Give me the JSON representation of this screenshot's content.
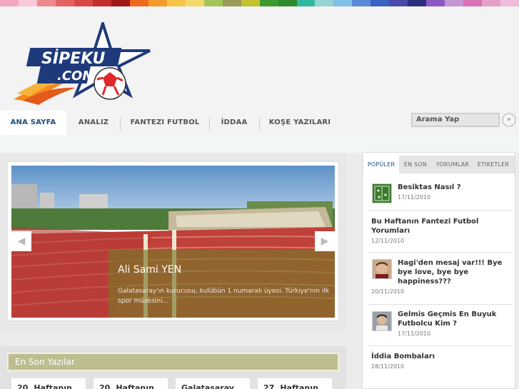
{
  "colors": {
    "strip": [
      "#f5a7c4",
      "#f7c9d6",
      "#ec8a8a",
      "#e36262",
      "#d94848",
      "#c42e2e",
      "#a01818",
      "#f06a1e",
      "#f49b2b",
      "#f7c44a",
      "#f5d86a",
      "#a3c459",
      "#9a9a5a",
      "#c2c22e",
      "#3d9b2e",
      "#2d8a2d",
      "#33b8a0",
      "#9ad3d3",
      "#7ec0e6",
      "#5a8ad6",
      "#3a62c2",
      "#4a4aaa",
      "#2e2e7e",
      "#8a5ac2",
      "#c496d6",
      "#d672b5",
      "#e6a0c8",
      "#f0bcd9"
    ],
    "nav_active_text": "#1e4b78",
    "latest_header_bg": "#bdbd8e"
  },
  "logo": {
    "text_line1": "SİPEKU",
    "text_line2": ".COM"
  },
  "nav": {
    "tabs": [
      {
        "label": "ANA SAYFA",
        "active": true
      },
      {
        "label": "ANALIZ"
      },
      {
        "label": "FANTEZI FUTBOL"
      },
      {
        "label": "İDDAA"
      },
      {
        "label": "KOŞE YAZILARI"
      }
    ]
  },
  "search": {
    "placeholder": "Arama Yap",
    "button_icon": "»"
  },
  "slider": {
    "title": "Ali Sami YEN",
    "text": "Galatasaray'ın kurucusu, kulübün 1 numaralı üyesi. Türkiye'nin ilk spor müzesini...",
    "prev_icon": "◀",
    "next_icon": "▶"
  },
  "latest": {
    "header": "En Son Yazılar",
    "cards": [
      "20. Haftanın",
      "20. Haftanın",
      "Galatasaray",
      "27. Haftanın"
    ]
  },
  "sidebar": {
    "tabs": [
      "POPÜLER",
      "EN SON",
      "YORUMLAR",
      "ETIKETLER"
    ],
    "posts": [
      {
        "title": "Besiktas Nasıl ?",
        "date": "17/11/2010",
        "thumb": "field"
      },
      {
        "title": "Bu Haftanın Fantezi Futbol Yorumları",
        "date": "12/11/2010",
        "thumb": ""
      },
      {
        "title": "Hagi'den mesaj var!!! Bye bye love, bye bye happiness???",
        "date": "20/11/2010",
        "thumb": "face"
      },
      {
        "title": "Gelmis Geçmis En Buyuk Futbolcu Kim ?",
        "date": "17/11/2010",
        "thumb": "player"
      },
      {
        "title": "İddia Bombaları",
        "date": "28/11/2010",
        "thumb": ""
      }
    ]
  }
}
